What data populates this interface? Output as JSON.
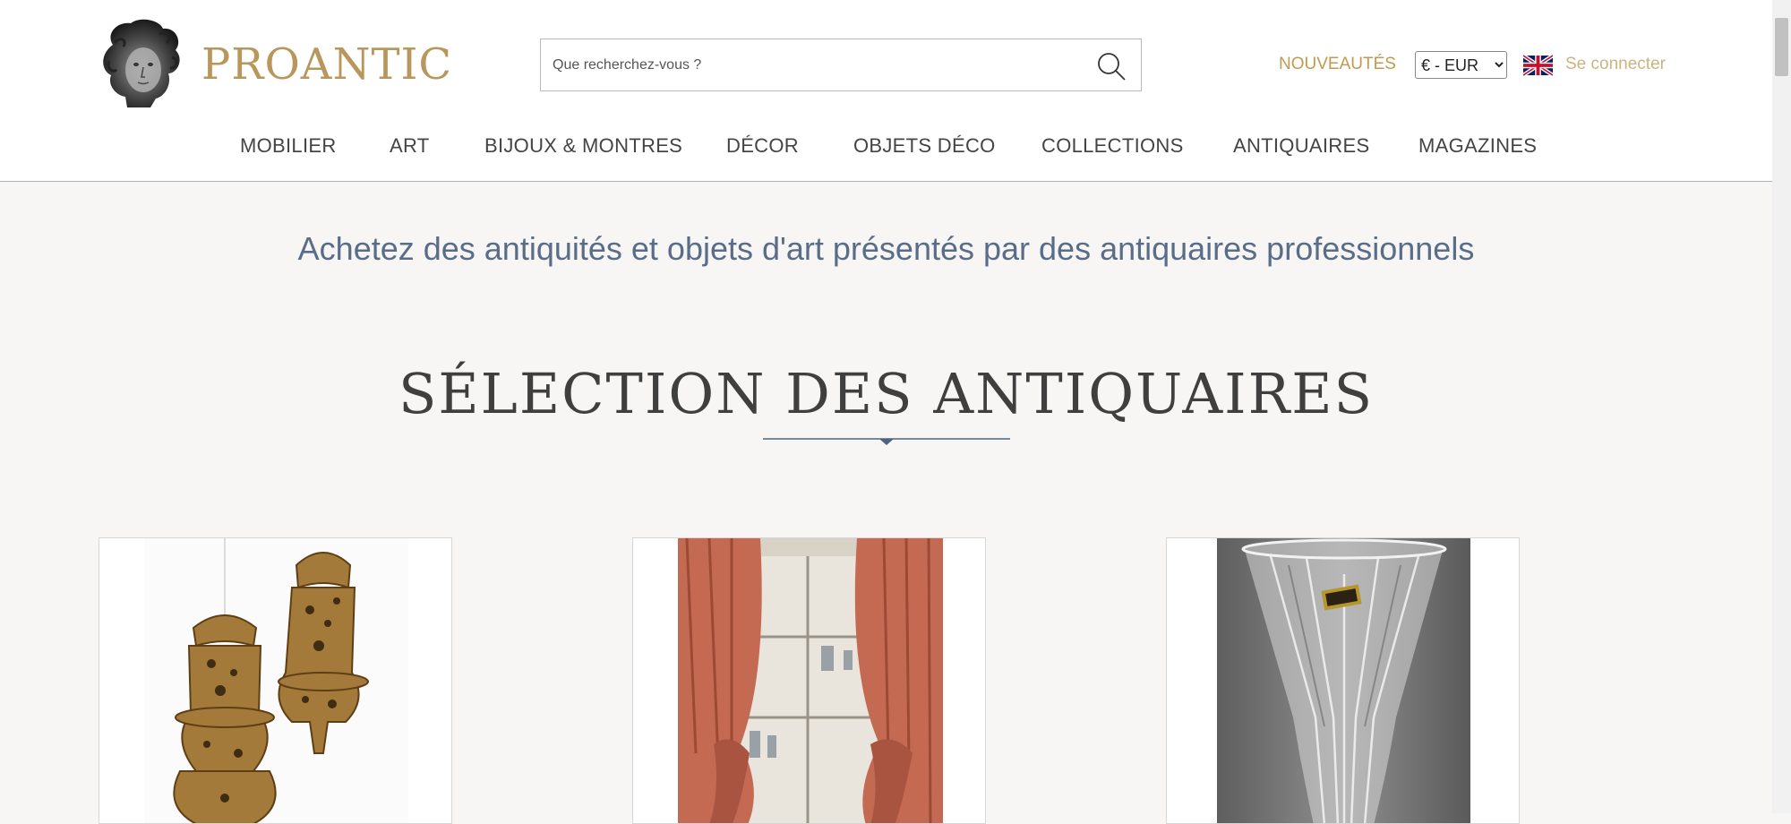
{
  "header": {
    "logo_text": "PROANTIC",
    "search": {
      "placeholder": "Que recherchez-vous ?"
    },
    "nouveautes": "NOUVEAUTÉS",
    "currency": {
      "selected": "€ - EUR",
      "options": [
        "€ - EUR"
      ]
    },
    "language_flag": "uk-flag-icon",
    "login": "Se connecter"
  },
  "nav": {
    "items": [
      {
        "label": "MOBILIER"
      },
      {
        "label": "ART"
      },
      {
        "label": "BIJOUX & MONTRES"
      },
      {
        "label": "DÉCOR"
      },
      {
        "label": "OBJETS DÉCO"
      },
      {
        "label": "COLLECTIONS"
      },
      {
        "label": "ANTIQUAIRES"
      },
      {
        "label": "MAGAZINES"
      }
    ]
  },
  "main": {
    "tagline": "Achetez des antiquités et objets d'art présentés par des antiquaires professionnels",
    "section_title": "SÉLECTION DES ANTIQUAIRES",
    "cards": [
      {
        "image": "gilded-wall-shelves-image"
      },
      {
        "image": "velvet-curtains-image"
      },
      {
        "image": "crystal-vase-image"
      }
    ]
  },
  "colors": {
    "brand_gold": "#b8965c",
    "accent_gold": "#c29a4e",
    "nav_text": "#444444",
    "tagline_blue": "#5a6d88",
    "background": "#f7f6f4"
  }
}
